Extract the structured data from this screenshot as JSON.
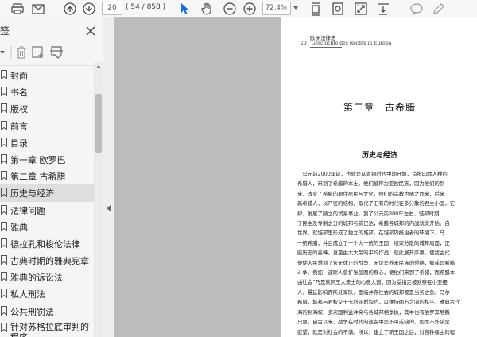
{
  "toolbar": {
    "page_current": "20",
    "page_count": "( 54 / 858 )",
    "zoom": "72.4%"
  },
  "sidebar": {
    "title": "签",
    "items": [
      {
        "label": "封面"
      },
      {
        "label": "书名"
      },
      {
        "label": "版权"
      },
      {
        "label": "前言"
      },
      {
        "label": "目录"
      },
      {
        "label": "第一章 欧罗巴"
      },
      {
        "label": "第二章 古希腊"
      },
      {
        "label": "历史与经济"
      },
      {
        "label": "法律问题"
      },
      {
        "label": "雅典"
      },
      {
        "label": "德拉孔和梭伦法律"
      },
      {
        "label": "古典时期的雅典宪章"
      },
      {
        "label": "雅典的诉讼法"
      },
      {
        "label": "私人刑法"
      },
      {
        "label": "公共刑罚法"
      },
      {
        "label": "针对苏格拉底审判的程序"
      }
    ]
  },
  "page": {
    "header_title": "欧洲法律史",
    "header_num": "20",
    "header_sub": "Geschichte des Rechts in Europa",
    "chapter": "第二章　古希腊",
    "section": "历史与经济",
    "lines": [
      "　公元前2000年前，也就是从青铜时代中期开始，首批印欧人种的",
      "希腊人，来到了希腊的本土。他们被称为亚欧民族，因为他们的到",
      "来，改变了希腊的原住居民与文化。他们的宗教也随之而来，后来",
      "新希腊人，以严密的结构，取代了旧有的时代在多分散的君主小国，它",
      "肆，发展了随之的贸易事业。到了公元前800年左右，城邦时期",
      "了民主及专制之分的城邦与新巴达，希腊各城邦的内战就此开始。自",
      "世界，就城邦里形成了独立的城邦，在城邦内统治者的环境下，马",
      "一统希腊，并且成立了一个大一统的王国，结束分散的城邦局面，正",
      "脑历史的高峰。直至由大大帝的平均作战，就此展开序幕。使我古代",
      "便使人民想到了永无休止的战争，无论是养来民族的侵略，抑或是希腊",
      "斗争。例如，波斯人曾扩张版图的野心，便他们来到了希腊，而希腊本",
      "由社会”乃是就阿王大流士的心意大道，因为受指定被欧察在小亚细",
      "人，曼延影响而所处军队，面临并存社会的城邦都是当务之急。马尔",
      "希腊，城邦与君权交于卡利亚斯和约，以维持两方之间的和平，雅典古代",
      "海的制海权，多次国利益冲突与各城邦相争执，其中也有伯罗奔尼撒",
      "只要。自古以来，战争在时代的遗留中是不可或缺的，因而不外乎是",
      "欲望，就是对社会的不满。所以，建立了新王国之后，对各种缘由的程"
    ]
  }
}
